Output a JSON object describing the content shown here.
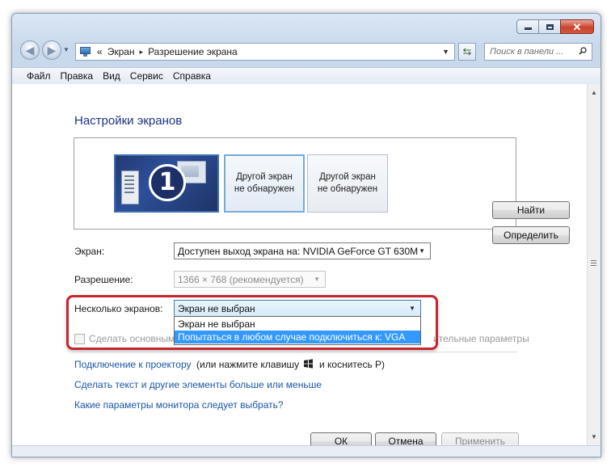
{
  "window": {
    "controls": {
      "minimize_icon": "minimize-icon",
      "maximize_icon": "maximize-icon",
      "close_icon": "close-icon"
    }
  },
  "nav": {
    "back_icon": "back-arrow-icon",
    "forward_icon": "forward-arrow-icon",
    "address": {
      "prefix": "«",
      "crumbs": [
        "Экран",
        "Разрешение экрана"
      ],
      "separator": "▸"
    },
    "refresh_icon": "refresh-icon",
    "search_placeholder": "Поиск в панели ..."
  },
  "menu": {
    "items": [
      {
        "label": "Файл"
      },
      {
        "label": "Правка"
      },
      {
        "label": "Вид"
      },
      {
        "label": "Сервис"
      },
      {
        "label": "Справка"
      }
    ]
  },
  "main": {
    "title": "Настройки экранов",
    "monitors": {
      "primary_number": "1",
      "other1_line1": "Другой экран",
      "other1_line2": "не обнаружен",
      "other2_line1": "Другой экран",
      "other2_line2": "не обнаружен"
    },
    "find_button": "Найти",
    "detect_button": "Определить",
    "screen_label": "Экран:",
    "screen_value": "Доступен выход экрана на: NVIDIA GeForce GT 630M",
    "resolution_label": "Разрешение:",
    "resolution_value": "1366 × 768 (рекомендуется)",
    "multi_label": "Несколько экранов:",
    "multi_value": "Экран не выбран",
    "multi_options": [
      "Экран не выбран",
      "Попытаться в любом случае подключиться к: VGA"
    ],
    "checkbox_label": "Сделать основным",
    "advanced_link": "ительные параметры",
    "link_projector": "Подключение к проектору",
    "link_projector_rest": "(или нажмите клавишу",
    "link_projector_rest2": "и коснитесь P)",
    "link_text_size": "Сделать текст и другие элементы больше или меньше",
    "link_monitor_params": "Какие параметры монитора следует выбрать?",
    "ok_button": "ОК",
    "cancel_button": "Отмена",
    "apply_button": "Применить"
  },
  "colors": {
    "highlight_border": "#c6252d",
    "link": "#1c56a6",
    "title": "#1e3287",
    "selection": "#3399ff"
  }
}
